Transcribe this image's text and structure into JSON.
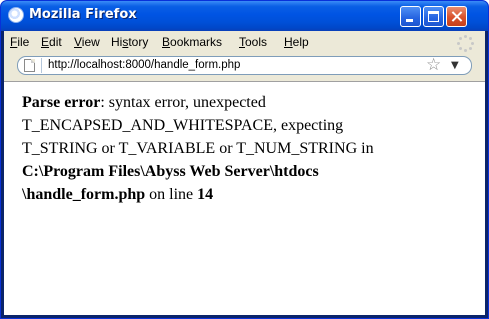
{
  "window": {
    "title": "Mozilla Firefox"
  },
  "menu": {
    "items": [
      {
        "label_rest": "ile",
        "mnemonic": "F"
      },
      {
        "label_rest": "dit",
        "mnemonic": "E"
      },
      {
        "label_rest": "iew",
        "mnemonic": "V"
      },
      {
        "label_pre": "Hi",
        "mnemonic": "s",
        "label_rest": "tory"
      },
      {
        "label_rest": "ookmarks",
        "mnemonic": "B"
      },
      {
        "label_rest": "ools",
        "mnemonic": "T"
      },
      {
        "label_rest": "elp",
        "mnemonic": "H"
      }
    ]
  },
  "navbar": {
    "url": "http://localhost:8000/handle_form.php",
    "bookmark_icon": "star-icon",
    "dropdown_icon": "chevron-down-icon"
  },
  "error": {
    "heading": "Parse error",
    "message_1": ": syntax error, unexpected",
    "message_2": "T_ENCAPSED_AND_WHITESPACE, expecting",
    "message_3": "T_STRING or T_VARIABLE or T_NUM_STRING in",
    "path_1": "C:\\Program Files\\Abyss Web Server\\htdocs",
    "path_2": "\\handle_form.php",
    "line_text": " on line ",
    "line_number": "14"
  }
}
